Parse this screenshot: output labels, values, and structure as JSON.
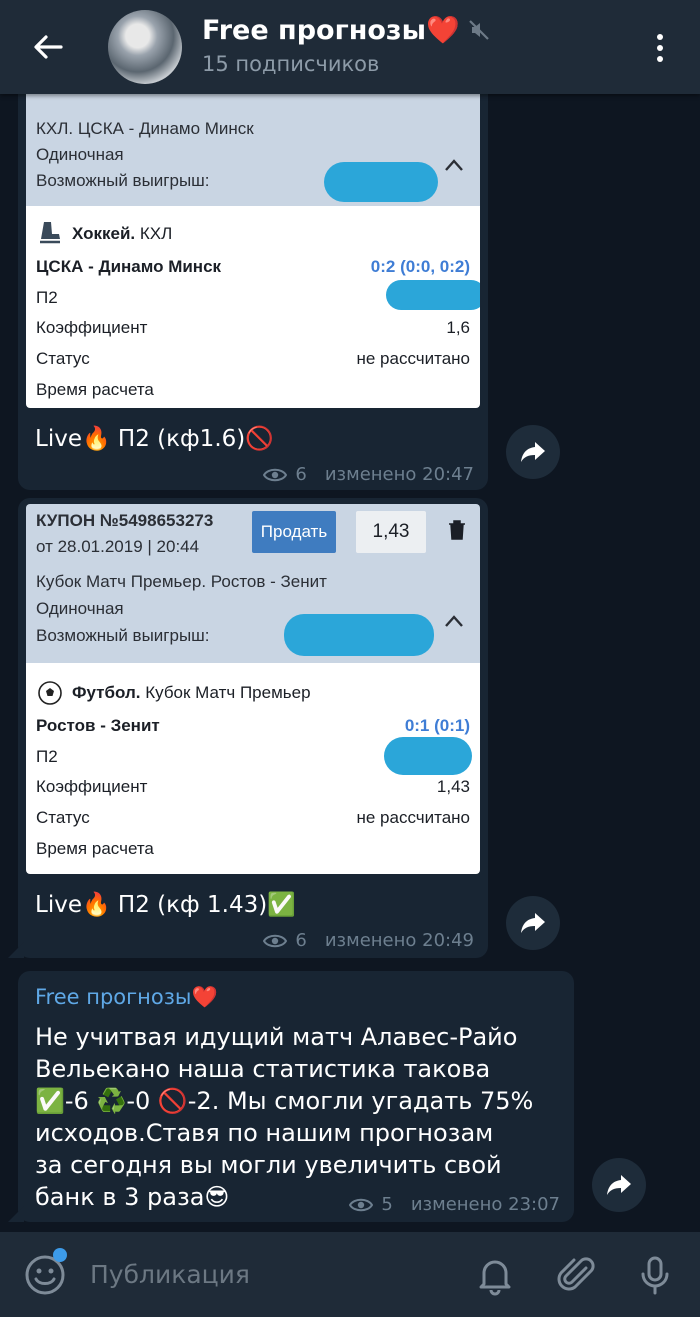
{
  "header": {
    "title": "Free прогнозы❤️",
    "subtitle": "15 подписчиков"
  },
  "msg1": {
    "event_line": "КХЛ. ЦСКА - Динамо Минск",
    "bet_type": "Одиночная",
    "win_label": "Возможный выигрыш:",
    "sport": "Хоккей.",
    "league": "КХЛ",
    "match": "ЦСКА - Динамо Минск",
    "score": "0:2 (0:0, 0:2)",
    "pick": "П2",
    "coef_label": "Коэффициент",
    "coef_value": "1,6",
    "status_label": "Статус",
    "status_value": "не рассчитано",
    "calc_label": "Время расчета",
    "caption": "Live🔥 П2 (кф1.6)🚫",
    "views": "6",
    "edited": "изменено 20:47"
  },
  "msg2": {
    "coupon_no": "КУПОН №5498653273",
    "coupon_date": "от 28.01.2019 | 20:44",
    "sell_label": "Продать",
    "odds": "1,43",
    "event_line": "Кубок Матч Премьер. Ростов - Зенит",
    "bet_type": "Одиночная",
    "win_label": "Возможный выигрыш:",
    "sport": "Футбол.",
    "league": "Кубок Матч Премьер",
    "match": "Ростов - Зенит",
    "score": "0:1 (0:1)",
    "pick": "П2",
    "coef_label": "Коэффициент",
    "coef_value": "1,43",
    "status_label": "Статус",
    "status_value": "не рассчитано",
    "calc_label": "Время расчета",
    "caption": "Live🔥 П2 (кф 1.43)✅",
    "views": "6",
    "edited": "изменено 20:49"
  },
  "msg3": {
    "sender": "Free прогнозы❤️",
    "lines": [
      "Не учитвая идущий матч Алавес-Райо",
      "Вельекано наша статистика такова",
      "✅-6  ♻️-0   🚫-2. Мы смогли угадать 75%",
      "исходов.Ставя по нашим прогнозам",
      "за сегодня вы могли увеличить свой",
      "банк в 3 раза😎"
    ],
    "views": "5",
    "edited": "изменено 23:07"
  },
  "composer": {
    "placeholder": "Публикация"
  },
  "colors": {
    "background": "#0e1621",
    "header": "#1f2b38",
    "bubble": "#182533",
    "accent": "#5fa8e6",
    "coupon_header": "#c9d5e3"
  }
}
